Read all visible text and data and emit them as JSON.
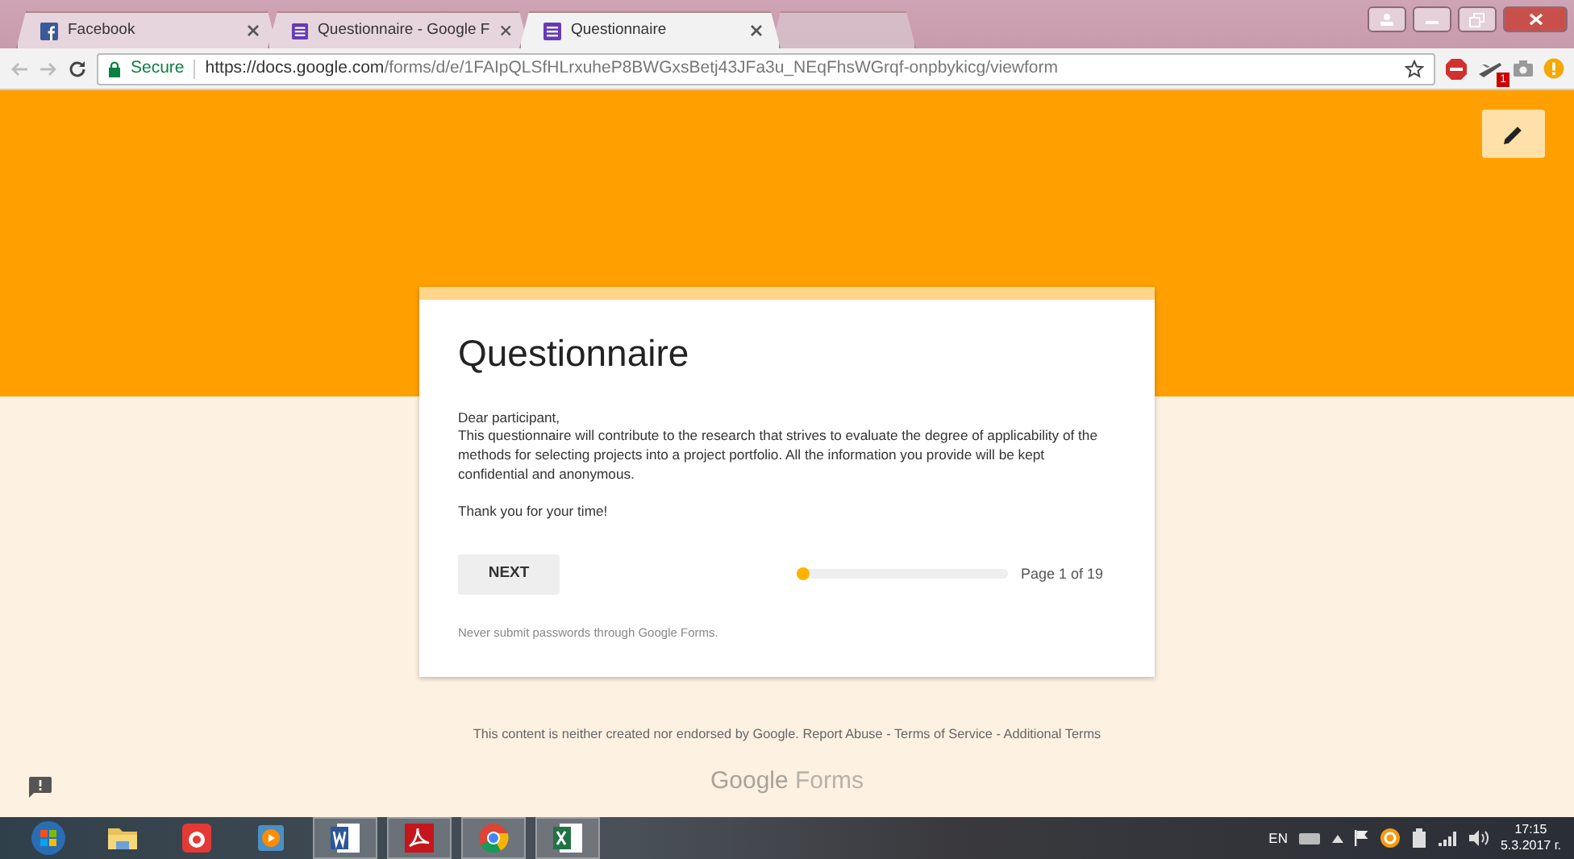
{
  "browser": {
    "tabs": [
      {
        "kind": "facebook",
        "label": "Facebook",
        "selected": false
      },
      {
        "kind": "forms",
        "label": "Questionnaire - Google F",
        "selected": false
      },
      {
        "kind": "forms",
        "label": "Questionnaire",
        "selected": true
      },
      {
        "kind": "blurred",
        "selected": false
      }
    ],
    "address_bar": {
      "security": "Secure",
      "url_host": "https://docs.google.com",
      "url_path": "/forms/d/e/1FAIpQLSfHLrxuheP8BWGxsBetj43JFa3u_NEqFhsWGrqf-onpbykicg/viewform"
    },
    "extension_badge": "1"
  },
  "form": {
    "title": "Questionnaire",
    "description": [
      "Dear participant,",
      "This questionnaire will contribute to the research that strives to evaluate the degree of applicability of the methods for selecting projects into a project portfolio. All the information you provide will be kept confidential and anonymous."
    ],
    "thanks": "Thank you for your time!",
    "next_button": "NEXT",
    "progress": {
      "level": 0.02,
      "label": "Page 1 of 19"
    },
    "warning": "Never submit passwords through Google Forms."
  },
  "footer": {
    "disclaimer": "This content is neither created nor endorsed by Google.",
    "links": [
      "Report Abuse",
      "Terms of Service",
      "Additional Terms"
    ],
    "separator": "-",
    "logo": [
      "Google",
      "Forms"
    ]
  },
  "taskbar": {
    "apps": [
      {
        "kind": "folder",
        "running": false
      },
      {
        "kind": "camera",
        "running": false
      },
      {
        "kind": "player",
        "running": false
      },
      {
        "kind": "word",
        "running": true
      },
      {
        "kind": "pdf",
        "running": true
      },
      {
        "kind": "chrome",
        "running": true
      },
      {
        "kind": "excel",
        "running": true
      }
    ],
    "language": "EN",
    "time": "17:15",
    "date": "5.3.2017 г."
  }
}
